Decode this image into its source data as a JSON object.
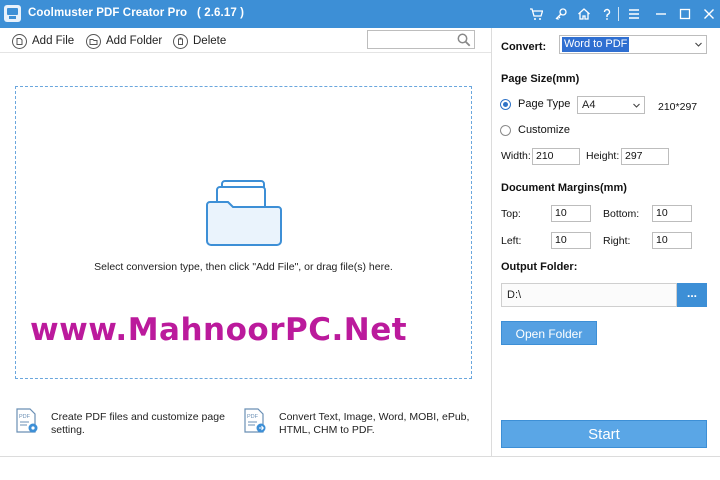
{
  "window": {
    "title": "Coolmuster PDF Creator Pro",
    "version": "( 2.6.17 )"
  },
  "toolbar": {
    "add_file": "Add File",
    "add_folder": "Add Folder",
    "delete": "Delete",
    "search_value": ""
  },
  "drop_zone": {
    "hint": "Select conversion type, then click \"Add File\", or drag file(s) here."
  },
  "watermark": "www.MahnoorPC.Net",
  "info": [
    {
      "text_line1": "Create PDF files and customize page",
      "text_line2": "setting.",
      "icon": "pdf-settings-icon"
    },
    {
      "text_line1": "Convert Text, Image, Word, MOBI, ePub,",
      "text_line2": "HTML, CHM to PDF.",
      "icon": "pdf-convert-icon"
    }
  ],
  "settings": {
    "convert_label": "Convert:",
    "convert_value": "Word to PDF",
    "page_size_heading": "Page Size(mm)",
    "page_type_label": "Page Type",
    "page_type_value": "A4",
    "page_type_dimensions": "210*297",
    "customize_label": "Customize",
    "page_type_checked": true,
    "width_label": "Width:",
    "width_value": "210",
    "height_label": "Height:",
    "height_value": "297",
    "margins_heading": "Document Margins(mm)",
    "top_label": "Top:",
    "top_value": "10",
    "bottom_label": "Bottom:",
    "bottom_value": "10",
    "left_label": "Left:",
    "left_value": "10",
    "right_label": "Right:",
    "right_value": "10",
    "output_folder_heading": "Output Folder:",
    "output_folder_value": "D:\\",
    "browse_label": "...",
    "open_folder_label": "Open Folder",
    "start_label": "Start"
  },
  "colors": {
    "title_bar": "#3d8fd6",
    "accent": "#5aa6e6",
    "watermark": "#bb1a9c"
  }
}
